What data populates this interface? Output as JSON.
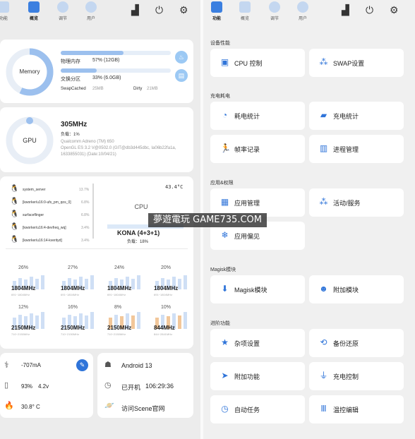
{
  "left_nav": {
    "tabs": [
      {
        "label": "功能"
      },
      {
        "label": "概览"
      },
      {
        "label": "调节"
      },
      {
        "label": "用户"
      }
    ]
  },
  "right_nav": {
    "tabs": [
      {
        "label": "功能"
      },
      {
        "label": "概览"
      },
      {
        "label": "调节"
      },
      {
        "label": "用户"
      }
    ]
  },
  "icons": {
    "chart": "chart-icon",
    "power": "power-icon",
    "settings": "gear-icon"
  },
  "memory": {
    "title": "Memory",
    "phys_label": "物理内存",
    "phys_val": "57% (12GB)",
    "phys_pct": 57,
    "swap_label": "交换分区",
    "swap_val": "33% (6.0GB)",
    "swap_pct": 33,
    "cached_label": "SwapCached",
    "cached_val": "25MB",
    "dirty_label": "Dirty",
    "dirty_val": "21MB"
  },
  "gpu": {
    "title": "GPU",
    "freq": "305MHz",
    "load": "负载：1%",
    "desc": "Qualcomm Adreno (TM) 650\nOpenGL ES 3.2 V@0502.0 (GIT@db3d445dbc, Ia06b22fa1a, 1633855031) (Date:10/04/21)"
  },
  "cpu": {
    "title": "CPU",
    "temp": "43.4°C",
    "model": "KONA (4+3+1)",
    "load": "负载：18%",
    "processes": [
      {
        "name": "system_server",
        "pct": "13.7%"
      },
      {
        "name": "[kworker/u16:0-ufs_pm_qos_0]",
        "pct": "6.8%"
      },
      {
        "name": "surfaceflinger",
        "pct": "6.8%"
      },
      {
        "name": "[kworker/u16:4-devfreq_wq]",
        "pct": "3.4%"
      },
      {
        "name": "[kworker/u16:14-kverityd]",
        "pct": "3.4%"
      }
    ],
    "cores": [
      {
        "pct": "26%",
        "freq": "1804MHz",
        "range": "691~1804MHz"
      },
      {
        "pct": "27%",
        "freq": "1804MHz",
        "range": "691~1804MHz"
      },
      {
        "pct": "24%",
        "freq": "1804MHz",
        "range": "691~1804MHz"
      },
      {
        "pct": "20%",
        "freq": "1804MHz",
        "range": "691~1804MHz"
      },
      {
        "pct": "12%",
        "freq": "2150MHz",
        "range": "710~2150MHz"
      },
      {
        "pct": "16%",
        "freq": "2150MHz",
        "range": "710~2150MHz"
      },
      {
        "pct": "8%",
        "freq": "2150MHz",
        "range": "710~2150MHz"
      },
      {
        "pct": "10%",
        "freq": "844MHz",
        "range": "844~2841MHz"
      }
    ]
  },
  "battery": {
    "current": "-707mA",
    "level": "93%",
    "voltage": "4.2v",
    "temp": "30.8° C"
  },
  "system": {
    "android": "Android 13",
    "uptime_label": "已开机",
    "uptime": "106:29:36",
    "visit": "访问Scene官网"
  },
  "watermark": "夢遊電玩 GAME735.COM",
  "sections": [
    {
      "title": "设备性能",
      "items": [
        {
          "label": "CPU 控制",
          "icon": "chip-icon"
        },
        {
          "label": "SWAP设置",
          "icon": "swap-icon"
        }
      ]
    },
    {
      "title": "充电耗电",
      "items": [
        {
          "label": "耗电统计",
          "icon": "pie-icon"
        },
        {
          "label": "充电统计",
          "icon": "charge-stat-icon"
        },
        {
          "label": "帧率记录",
          "icon": "runner-icon"
        },
        {
          "label": "进程管理",
          "icon": "process-icon"
        }
      ]
    },
    {
      "title": "应用&权限",
      "items": [
        {
          "label": "应用管理",
          "icon": "apps-icon"
        },
        {
          "label": "活动/服务",
          "icon": "activity-icon"
        },
        {
          "label": "应用偏见",
          "icon": "snowflake-icon"
        }
      ]
    },
    {
      "title": "Magisk模块",
      "items": [
        {
          "label": "Magisk模块",
          "icon": "download-icon"
        },
        {
          "label": "附加模块",
          "icon": "mask-icon"
        }
      ]
    },
    {
      "title": "进阶功能",
      "items": [
        {
          "label": "杂项设置",
          "icon": "star-icon"
        },
        {
          "label": "备份还原",
          "icon": "backup-icon"
        },
        {
          "label": "附加功能",
          "icon": "terminal-icon"
        },
        {
          "label": "充电控制",
          "icon": "plug-icon"
        },
        {
          "label": "自动任务",
          "icon": "clock-icon"
        },
        {
          "label": "温控编辑",
          "icon": "mi-icon"
        }
      ]
    }
  ]
}
